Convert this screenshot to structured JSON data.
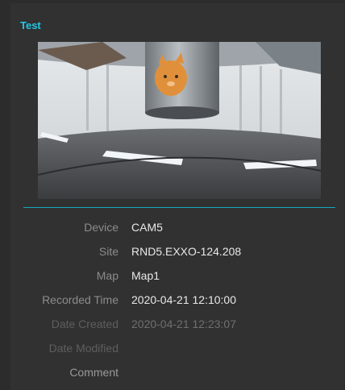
{
  "event": {
    "title": "Test",
    "thumbnail_icon": "camera-snapshot",
    "details": [
      {
        "label": "Device",
        "value": "CAM5"
      },
      {
        "label": "Site",
        "value": "RND5.EXXO-124.208"
      },
      {
        "label": "Map",
        "value": "Map1"
      },
      {
        "label": "Recorded Time",
        "value": "2020-04-21 12:10:00"
      },
      {
        "label": "Date Created",
        "value": "2020-04-21 12:23:07"
      },
      {
        "label": "Date Modified",
        "value": ""
      },
      {
        "label": "Comment",
        "value": ""
      }
    ]
  },
  "colors": {
    "accent": "#1fc8e6",
    "background": "#313131"
  }
}
